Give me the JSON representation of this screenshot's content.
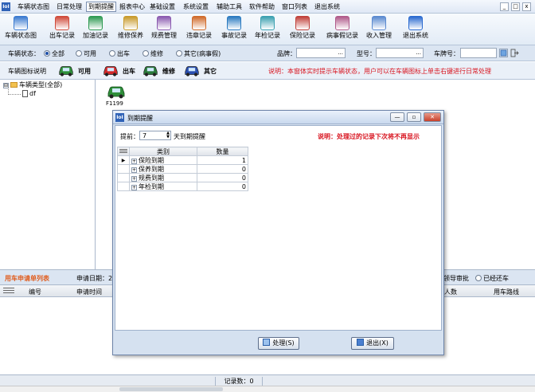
{
  "menu": {
    "items": [
      "车辆状态图",
      "日常处理",
      "到期提醒",
      "报表中心",
      "基础设置",
      "系统设置",
      "辅助工具",
      "软件帮助",
      "窗口列表",
      "退出系统"
    ],
    "active": "到期提醒",
    "window_controls": [
      "_",
      "□",
      "x"
    ]
  },
  "toolbar": {
    "buttons": [
      {
        "label": "车辆状态图",
        "icon": "car-status-icon",
        "color": "#3a7ad0"
      },
      {
        "label": "出车记录",
        "icon": "car-out-icon",
        "color": "#d04a3a"
      },
      {
        "label": "加油记录",
        "icon": "fuel-icon",
        "color": "#2e9a52"
      },
      {
        "label": "维修保养",
        "icon": "wrench-icon",
        "color": "#c89a2a"
      },
      {
        "label": "规费管理",
        "icon": "fee-icon",
        "color": "#8a5ab0"
      },
      {
        "label": "违章记录",
        "icon": "violation-icon",
        "color": "#d06a2a"
      },
      {
        "label": "事故记录",
        "icon": "accident-icon",
        "color": "#2a7ac0"
      },
      {
        "label": "年检记录",
        "icon": "inspection-icon",
        "color": "#3aa0b0"
      },
      {
        "label": "保险记录",
        "icon": "insurance-icon",
        "color": "#c0403a"
      },
      {
        "label": "病事假记录",
        "icon": "leave-icon",
        "color": "#b05a8a"
      },
      {
        "label": "收入管理",
        "icon": "income-icon",
        "color": "#5a8ad0"
      },
      {
        "label": "退出系统",
        "icon": "exit-icon",
        "color": "#2a6ad0"
      }
    ]
  },
  "filter": {
    "status_label": "车辆状态：",
    "options": [
      "全部",
      "可用",
      "出车",
      "维修",
      "其它(病事假)"
    ],
    "selected": "全部",
    "brand_label": "品牌：",
    "brand_value": "...",
    "model_label": "型号：",
    "model_value": "...",
    "plate_label": "车牌号："
  },
  "legend": {
    "label": "车辆图标说明",
    "items": [
      {
        "label": "可用",
        "color": "#2f8f3a"
      },
      {
        "label": "出车",
        "color": "#d22a2a"
      },
      {
        "label": "维修",
        "color": "#2a7a3a"
      },
      {
        "label": "其它",
        "color": "#2a4fb0"
      }
    ],
    "note": "说明：本窗体实时提示车辆状态，用户可以在车辆图标上单击右键进行日常处理"
  },
  "tree": {
    "root": "车辆类型(全部)",
    "root_toggle": "⊟",
    "children": [
      "df"
    ]
  },
  "canvas": {
    "vehicle_plate": "F1199",
    "vehicle_color": "#2f8f3a"
  },
  "bottom": {
    "title": "用车申请单列表",
    "date_label": "申请日期：",
    "date_value": "2",
    "approve_label": "领导审批",
    "returned_label": "已经还车",
    "columns": [
      "编号",
      "申请时间"
    ],
    "right_columns": [
      "人数",
      "用车路线"
    ]
  },
  "status": {
    "record_count": "记录数：0"
  },
  "dialog": {
    "title": "到期提醒",
    "advance_label": "提前：",
    "advance_value": "7",
    "advance_suffix": "天到期提醒",
    "note": "说明：处理过的记录下次将不再显示",
    "grid": {
      "headers": [
        "类别",
        "数量"
      ],
      "rows": [
        {
          "category": "保险到期",
          "count": "1"
        },
        {
          "category": "保养到期",
          "count": "0"
        },
        {
          "category": "规费到期",
          "count": "0"
        },
        {
          "category": "年检到期",
          "count": "0"
        }
      ]
    },
    "process_button": "处理(S)",
    "exit_button": "退出(X)"
  }
}
